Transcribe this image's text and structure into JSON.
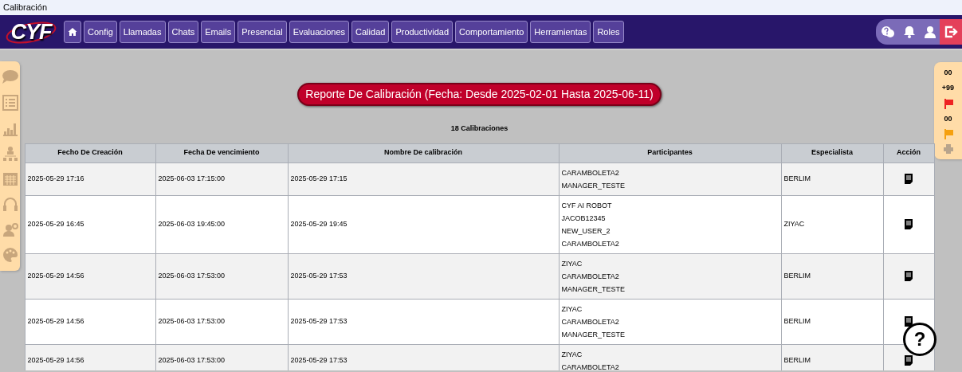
{
  "window": {
    "title": "Calibración"
  },
  "logo": {
    "text": "CYF"
  },
  "nav": [
    {
      "kind": "home"
    },
    {
      "kind": "text",
      "label": "Config"
    },
    {
      "kind": "text",
      "label": "Llamadas"
    },
    {
      "kind": "text",
      "label": "Chats"
    },
    {
      "kind": "text",
      "label": "Emails"
    },
    {
      "kind": "text",
      "label": "Presencial"
    },
    {
      "kind": "text",
      "label": "Evaluaciones"
    },
    {
      "kind": "text",
      "label": "Calidad"
    },
    {
      "kind": "text",
      "label": "Productividad"
    },
    {
      "kind": "text",
      "label": "Comportamiento"
    },
    {
      "kind": "text",
      "label": "Herramientas"
    },
    {
      "kind": "text",
      "label": "Roles"
    }
  ],
  "report": {
    "title": "Reporte De Calibración (Fecha: Desde 2025-02-01 Hasta 2025-06-11)",
    "count": "18 Calibraciones"
  },
  "right_panel": [
    {
      "kind": "count",
      "text": "00"
    },
    {
      "kind": "count",
      "text": "+99"
    },
    {
      "kind": "flag",
      "color": "#ee2222"
    },
    {
      "kind": "count",
      "text": "00"
    },
    {
      "kind": "flag",
      "color": "#f5a00f"
    },
    {
      "kind": "print"
    }
  ],
  "table": {
    "columns": [
      "Fecho De Creación",
      "Fecha De vencimiento",
      "Nombre De calibración",
      "Participantes",
      "Especialista",
      "Acción"
    ],
    "rows": [
      {
        "created": "2025-05-29 17:16",
        "due": "2025-06-03 17:15:00",
        "name": "2025-05-29 17:15",
        "participants": [
          "CARAMBOLETA2",
          "MANAGER_TESTE"
        ],
        "specialist": "BERLIM"
      },
      {
        "created": "2025-05-29 16:45",
        "due": "2025-06-03 19:45:00",
        "name": "2025-05-29 19:45",
        "participants": [
          "CYF AI ROBOT",
          "JACOB12345",
          "NEW_USER_2",
          "CARAMBOLETA2"
        ],
        "specialist": "ZIYAC"
      },
      {
        "created": "2025-05-29 14:56",
        "due": "2025-06-03 17:53:00",
        "name": "2025-05-29 17:53",
        "participants": [
          "ZIYAC",
          "CARAMBOLETA2",
          "MANAGER_TESTE"
        ],
        "specialist": "BERLIM"
      },
      {
        "created": "2025-05-29 14:56",
        "due": "2025-06-03 17:53:00",
        "name": "2025-05-29 17:53",
        "participants": [
          "ZIYAC",
          "CARAMBOLETA2",
          "MANAGER_TESTE"
        ],
        "specialist": "BERLIM"
      },
      {
        "created": "2025-05-29 14:56",
        "due": "2025-06-03 17:53:00",
        "name": "2025-05-29 17:53",
        "participants": [
          "ZIYAC",
          "CARAMBOLETA2"
        ],
        "specialist": "BERLIM"
      }
    ]
  },
  "help": {
    "text": "?"
  }
}
